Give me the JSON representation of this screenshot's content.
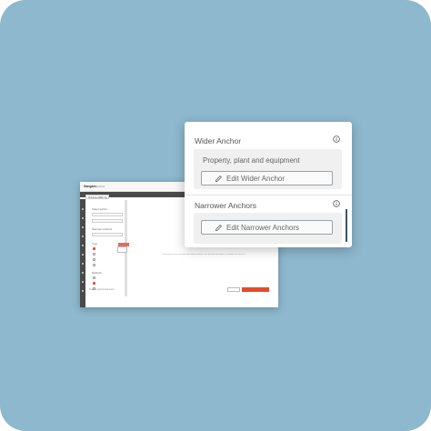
{
  "app": {
    "logo": "Sangam",
    "nav": "Anchor",
    "tab": "IS Forms NBC Tg",
    "sidebar": {
      "label1": "Select anchor",
      "label2": "Narrower anchors",
      "label3": "Type",
      "label4": "Methods"
    },
    "footer_text": "Select a parent document",
    "main_text": "Get started: select anchors and review content, link relevant documents to explore the anchor results"
  },
  "panel": {
    "wider": {
      "title": "Wider Anchor",
      "value": "Property, plant and equipment",
      "button": "Edit Wider Anchor"
    },
    "narrower": {
      "title": "Narrower Anchors",
      "button": "Edit Narrower Anchors"
    }
  },
  "colors": {
    "background": "#8db8cd",
    "accent": "#e44b2b",
    "scrollbar": "#3c5366"
  }
}
